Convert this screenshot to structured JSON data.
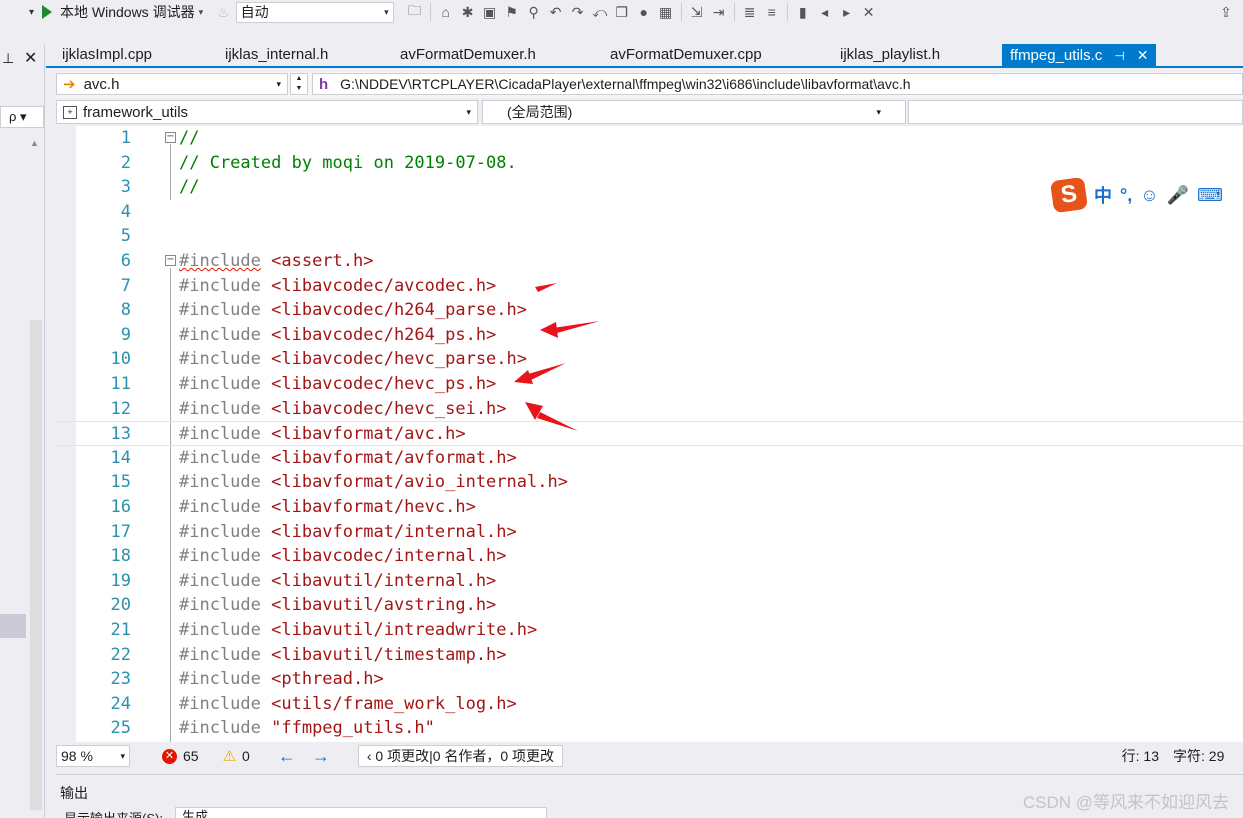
{
  "toolbar": {
    "run_label": "本地 Windows 调试器",
    "config_value": "自动"
  },
  "left_panel": {
    "search_placeholder": "ρ"
  },
  "tabs": [
    {
      "label": "ijklasImpl.cpp",
      "active": false
    },
    {
      "label": "ijklas_internal.h",
      "active": false
    },
    {
      "label": "avFormatDemuxer.h",
      "active": false
    },
    {
      "label": "avFormatDemuxer.cpp",
      "active": false
    },
    {
      "label": "ijklas_playlist.h",
      "active": false
    },
    {
      "label": "ffmpeg_utils.c",
      "active": true
    }
  ],
  "navbar": {
    "file": "avc.h",
    "path": "G:\\NDDEV\\RTCPLAYER\\CicadaPlayer\\external\\ffmpeg\\win32\\i686\\include\\libavformat\\avc.h"
  },
  "scopebar": {
    "project": "framework_utils",
    "scope": "(全局范围)"
  },
  "editor": {
    "lines": [
      {
        "n": "1",
        "text": "//"
      },
      {
        "n": "2",
        "text": "// Created by moqi on 2019-07-08."
      },
      {
        "n": "3",
        "text": "//"
      },
      {
        "n": "4",
        "text": ""
      },
      {
        "n": "5",
        "text": ""
      },
      {
        "n": "6",
        "text": "#include <assert.h>"
      },
      {
        "n": "7",
        "text": "#include <libavcodec/avcodec.h>"
      },
      {
        "n": "8",
        "text": "#include <libavcodec/h264_parse.h>"
      },
      {
        "n": "9",
        "text": "#include <libavcodec/h264_ps.h>"
      },
      {
        "n": "10",
        "text": "#include <libavcodec/hevc_parse.h>"
      },
      {
        "n": "11",
        "text": "#include <libavcodec/hevc_ps.h>"
      },
      {
        "n": "12",
        "text": "#include <libavcodec/hevc_sei.h>"
      },
      {
        "n": "13",
        "text": "#include <libavformat/avc.h>"
      },
      {
        "n": "14",
        "text": "#include <libavformat/avformat.h>"
      },
      {
        "n": "15",
        "text": "#include <libavformat/avio_internal.h>"
      },
      {
        "n": "16",
        "text": "#include <libavformat/hevc.h>"
      },
      {
        "n": "17",
        "text": "#include <libavformat/internal.h>"
      },
      {
        "n": "18",
        "text": "#include <libavcodec/internal.h>"
      },
      {
        "n": "19",
        "text": "#include <libavutil/internal.h>"
      },
      {
        "n": "20",
        "text": "#include <libavutil/avstring.h>"
      },
      {
        "n": "21",
        "text": "#include <libavutil/intreadwrite.h>"
      },
      {
        "n": "22",
        "text": "#include <libavutil/timestamp.h>"
      },
      {
        "n": "23",
        "text": "#include <pthread.h>"
      },
      {
        "n": "24",
        "text": "#include <utils/frame_work_log.h>"
      },
      {
        "n": "25",
        "text": "#include \"ffmpeg_utils.h\""
      }
    ],
    "current_line": 13
  },
  "ime": {
    "logo": "S",
    "items": [
      "中",
      "°,",
      "☺",
      "🎤",
      "⌨"
    ]
  },
  "statusbar": {
    "zoom": "98 %",
    "errors": "65",
    "warnings": "0",
    "changes": "0 项更改|0 名作者，0 项更改",
    "line": "行: 13",
    "char": "字符: 29"
  },
  "output": {
    "title": "输出",
    "source_label": "显示输出来源(S):",
    "source_value": "生成"
  },
  "watermark": "CSDN @等风来不如迎风去",
  "colors": {
    "accent": "#007acc",
    "comment": "#008000",
    "preprocessor": "#808080",
    "string": "#a31515",
    "line_number": "#2b91af",
    "annotation_arrow": "#e8141c"
  }
}
